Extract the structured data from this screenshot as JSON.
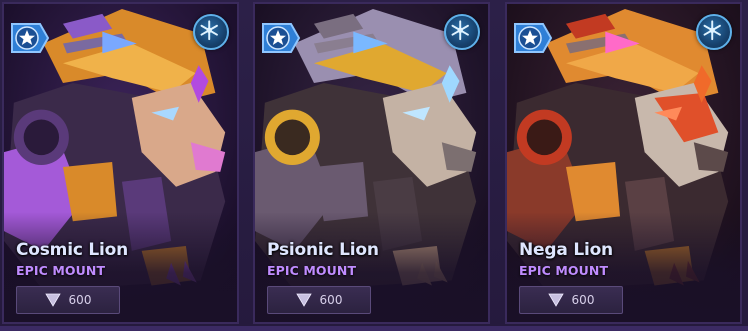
{
  "cards": [
    {
      "title": "Cosmic Lion",
      "subtitle": "EPIC MOUNT",
      "price": "600",
      "colors": {
        "armor": "#d98a2a",
        "accent": "#a45ad8",
        "face": "#d9a88a",
        "nose": "#e07ad0",
        "eye": "#a9d8ff",
        "shade": "#5a3a7a",
        "dark": "#3b2a4a"
      }
    },
    {
      "title": "Psionic Lion",
      "subtitle": "EPIC MOUNT",
      "price": "600",
      "colors": {
        "armor": "#e0a830",
        "accent": "#9a8fb0",
        "face": "#c4b2a4",
        "nose": "#7c6f70",
        "eye": "#bfe6ff",
        "shade": "#6a5a70",
        "dark": "#3f3238"
      }
    },
    {
      "title": "Nega Lion",
      "subtitle": "EPIC MOUNT",
      "price": "600",
      "colors": {
        "armor": "#e08a30",
        "accent": "#c23a22",
        "face": "#c8b8ac",
        "nose": "#5c4a4a",
        "eye": "#ff8a5a",
        "shade": "#8a3a2a",
        "dark": "#3b2a30"
      }
    }
  ],
  "icons": {
    "rarity": "star-badge-icon",
    "event": "snowflake-icon",
    "currency": "gem-icon"
  },
  "palette": {
    "title_text": "#dfe6ff",
    "subtitle_text": "#c08cff",
    "star_badge": "#2f7fd6",
    "snow_badge": "#1d5d96"
  }
}
